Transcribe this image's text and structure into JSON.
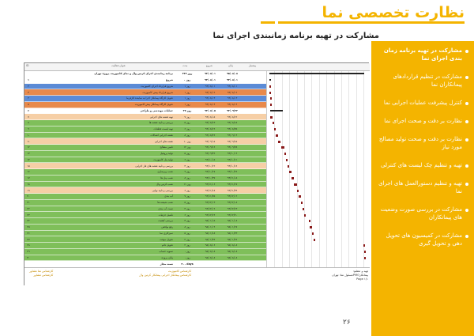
{
  "header": {
    "brand": "نظارت تخصصی نما",
    "title": "مشارکت در تهیه برنامه زمانبندی اجرای نما"
  },
  "side_panel": {
    "items": [
      {
        "label": "مشارکت در تهیه برنامه زمان بندی اجرای نما",
        "active": true
      },
      {
        "label": "مشارکت در تنظیم قراردادهای پیمانکاران نما",
        "active": false
      },
      {
        "label": "کنترل پیشرفت عملیات اجرایی نما",
        "active": false
      },
      {
        "label": "نظارت بر دقت و صحت اجرای نما",
        "active": false
      },
      {
        "label": "نظارت بر دقت و صحت تولید مصالح مورد نیاز",
        "active": false
      },
      {
        "label": "تهیه و تنظیم چک لیست های کنترلی",
        "active": false
      },
      {
        "label": "تهیه و تنظیم دستورالعمل های اجرای نما",
        "active": false
      },
      {
        "label": "مشارکت در بررسی صورت وضعیت های پیمانکاران",
        "active": false
      },
      {
        "label": "مشارکت در کمیسیون های تحویل دهی و تحویل گیری",
        "active": false
      }
    ]
  },
  "gantt": {
    "headers": {
      "num": "ID",
      "name": "عنوان فعالیت",
      "duration": "مدت",
      "start": "شروع",
      "finish": "پایان",
      "pred": "پیشنیاز"
    },
    "rows": [
      {
        "num": "",
        "name": "برنامه زمانبندی اجرای کرتین وال و نمای کامپوزیت پروژه تهران",
        "duration": "۳۴۲ روز",
        "start": "۹۴/۰۸/۰۱",
        "finish": "۹۵/۰۸/۰۸",
        "color": "#ffffff",
        "bold": true
      },
      {
        "num": "۱",
        "name": "شروع",
        "duration": "۰ روز",
        "start": "۹۴/۰۸/۰۱",
        "finish": "۹۴/۰۸/۰۱",
        "color": "#ffffff",
        "bold": true
      },
      {
        "num": "۲",
        "name": "شروع قرارداد اجرای کامپوزیت",
        "duration": "۱ روز",
        "start": "۹۴/۰۸/۰۱",
        "finish": "۹۴/۰۸/۰۱",
        "color": "#5b8bd6",
        "bold": false
      },
      {
        "num": "۳",
        "name": "شروع قرارداد پیش کامپوزیت",
        "duration": "۱ روز",
        "start": "۹۴/۰۸/۰۲",
        "finish": "۹۴/۰۸/۰۲",
        "color": "#e8894a",
        "bold": false
      },
      {
        "num": "۴",
        "name": "تحویل کارگاه پیمانکار اجرا به نماینده کارفرما",
        "duration": "۱ روز",
        "start": "۹۴/۰۸/۰۳",
        "finish": "۹۴/۰۸/۰۳",
        "color": "#5b8bd6",
        "bold": false
      },
      {
        "num": "۵",
        "name": "تحویل کارگاه پیمانکار پیش کامپوزیت",
        "duration": "۱ روز",
        "start": "۹۴/۰۸/۰۴",
        "finish": "۹۴/۰۸/۰۴",
        "color": "#e8894a",
        "bold": false
      },
      {
        "num": "۶",
        "name": "عملیات مهندسی و طراحی",
        "duration": "۴۷ روز",
        "start": "۹۴/۰۸/۰۵",
        "finish": "۹۴/۰۹/۲۲",
        "color": "#ffffff",
        "bold": true
      },
      {
        "num": "۷",
        "name": "تهیه نقشه های اجرایی",
        "duration": "۷ روز",
        "start": "۹۴/۰۸/۰۵",
        "finish": "۹۴/۰۸/۱۲",
        "color": "#f6cfa6",
        "bold": false
      },
      {
        "num": "۸",
        "name": "بررسی و تایید نقشه ها",
        "duration": "۵ روز",
        "start": "۹۴/۰۸/۱۳",
        "finish": "۹۴/۰۸/۱۸",
        "color": "#7fbf5a",
        "bold": false
      },
      {
        "num": "۹",
        "name": "تهیه لیست قطعات",
        "duration": "۶ روز",
        "start": "۹۴/۰۸/۱۹",
        "finish": "۹۴/۰۸/۲۵",
        "color": "#7fbf5a",
        "bold": false
      },
      {
        "num": "۱۰",
        "name": "نقشه اجرایی اتصالات",
        "duration": "۸ روز",
        "start": "۹۴/۰۸/۲۶",
        "finish": "۹۴/۰۹/۰۴",
        "color": "#7fbf5a",
        "bold": false
      },
      {
        "num": "۱۱",
        "name": "نقشه های اجرایی",
        "duration": "۱۰ روز",
        "start": "۹۴/۰۹/۰۵",
        "finish": "۹۴/۰۹/۱۵",
        "color": "#f6cfa6",
        "bold": false
      },
      {
        "num": "۱۲",
        "name": "تامین مصالح",
        "duration": "۱۲ روز",
        "start": "۹۴/۰۹/۱۶",
        "finish": "۹۴/۰۹/۲۸",
        "color": "#7fbf5a",
        "bold": false
      },
      {
        "num": "۱۳",
        "name": "تولید پروفیل",
        "duration": "۵ روز",
        "start": "۹۴/۰۹/۲۹",
        "finish": "۹۴/۱۰/۰۴",
        "color": "#7fbf5a",
        "bold": false
      },
      {
        "num": "۱۴",
        "name": "تولید پنل کامپوزیت",
        "duration": "۶ روز",
        "start": "۹۴/۱۰/۰۵",
        "finish": "۹۴/۱۰/۱۱",
        "color": "#7fbf5a",
        "bold": false
      },
      {
        "num": "۱۵",
        "name": "بررسی و تایید نقشه های فاز اجرایی",
        "duration": "۴ روز",
        "start": "۹۴/۱۰/۱۲",
        "finish": "۹۴/۱۰/۱۶",
        "color": "#f6cfa6",
        "bold": false
      },
      {
        "num": "۱۶",
        "name": "نصب زیرسازی",
        "duration": "۹ روز",
        "start": "۹۴/۱۰/۱۷",
        "finish": "۹۴/۱۰/۲۶",
        "color": "#7fbf5a",
        "bold": false
      },
      {
        "num": "۱۷",
        "name": "نصب پنل ها",
        "duration": "۸ روز",
        "start": "۹۴/۱۰/۲۷",
        "finish": "۹۴/۱۱/۰۵",
        "color": "#7fbf5a",
        "bold": false
      },
      {
        "num": "۱۸",
        "name": "نصب کرتین وال",
        "duration": "۱۱ روز",
        "start": "۹۴/۱۱/۰۶",
        "finish": "۹۴/۱۱/۱۷",
        "color": "#7fbf5a",
        "bold": false
      },
      {
        "num": "۱۹",
        "name": "بررسی و تایید نهایی",
        "duration": "۶ روز",
        "start": "۹۴/۱۱/۱۸",
        "finish": "۹۴/۱۱/۲۴",
        "color": "#f6cfa6",
        "bold": false
      },
      {
        "num": "۲۰",
        "name": "آب بندی",
        "duration": "۷ روز",
        "start": "۹۴/۱۱/۲۵",
        "finish": "۹۴/۱۲/۰۲",
        "color": "#7fbf5a",
        "bold": false
      },
      {
        "num": "۲۱",
        "name": "نصب شیشه ها",
        "duration": "۵ روز",
        "start": "۹۴/۱۲/۰۳",
        "finish": "۹۴/۱۲/۰۸",
        "color": "#7fbf5a",
        "bold": false
      },
      {
        "num": "۲۲",
        "name": "تست آب بندی",
        "duration": "۴ روز",
        "start": "۹۴/۱۲/۰۹",
        "finish": "۹۴/۱۲/۱۳",
        "color": "#7fbf5a",
        "bold": false
      },
      {
        "num": "۲۳",
        "name": "تکمیل جزئیات",
        "duration": "۶ روز",
        "start": "۹۴/۱۲/۱۴",
        "finish": "۹۴/۱۲/۲۰",
        "color": "#7fbf5a",
        "bold": false
      },
      {
        "num": "۲۴",
        "name": "بررسی کیفیت",
        "duration": "۳ روز",
        "start": "۹۵/۰۱/۰۵",
        "finish": "۹۵/۰۱/۰۸",
        "color": "#7fbf5a",
        "bold": false
      },
      {
        "num": "۲۵",
        "name": "رفع نواقص",
        "duration": "۸ روز",
        "start": "۹۵/۰۱/۰۹",
        "finish": "۹۵/۰۱/۱۷",
        "color": "#7fbf5a",
        "bold": false
      },
      {
        "num": "۲۶",
        "name": "تمیزکاری نما",
        "duration": "۵ روز",
        "start": "۹۵/۰۱/۱۸",
        "finish": "۹۵/۰۱/۲۳",
        "color": "#7fbf5a",
        "bold": false
      },
      {
        "num": "۲۷",
        "name": "تحویل موقت",
        "duration": "۲ روز",
        "start": "۹۵/۰۱/۲۴",
        "finish": "۹۵/۰۱/۲۶",
        "color": "#7fbf5a",
        "bold": false
      },
      {
        "num": "۲۸",
        "name": "تحویل دائم",
        "duration": "۲ روز",
        "start": "۹۵/۰۸/۰۶",
        "finish": "۹۵/۰۸/۰۸",
        "color": "#7fbf5a",
        "bold": false
      },
      {
        "num": "۲۹",
        "name": "تسویه حساب",
        "duration": "۰ روز",
        "start": "۹۵/۰۸/۰۸",
        "finish": "۹۵/۰۸/۰۸",
        "color": "#7fbf5a",
        "bold": false
      },
      {
        "num": "۳۰",
        "name": "پایان پروژه",
        "duration": "۰ روز",
        "start": "۹۵/۰۸/۰۸",
        "finish": "۹۵/۰۸/۰۸",
        "color": "#7fbf5a",
        "bold": false
      },
      {
        "num": "",
        "name": "تست مجاز",
        "duration": "۴۰۰ days",
        "start": "",
        "finish": "",
        "color": "#ffffff",
        "bold": true
      }
    ],
    "footer": {
      "left_line1": "تهیه و تنظیم:",
      "left_line2": "پیمانکارPMOمسئول نما: تهران",
      "left_line3": "Page ۱/۱",
      "mid_line1": "کارشناس کامپوزیت",
      "mid_line2": "کارشناس پیمانکار اجرایی پیمانکار کرتین وال",
      "right_line1": "کارشناس نما مشاور",
      "right_line2": "کارشناس مشاور"
    }
  },
  "page_number": "۲۶"
}
